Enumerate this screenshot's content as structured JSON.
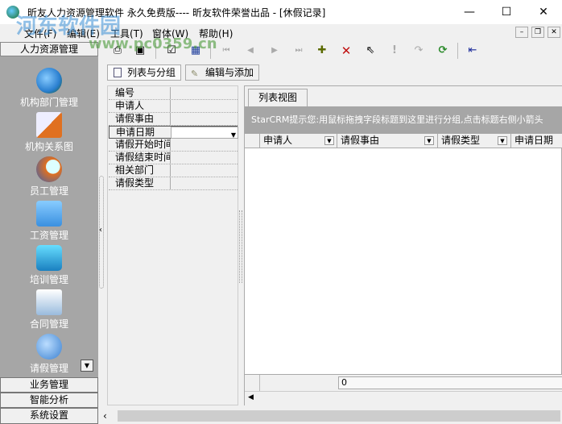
{
  "window": {
    "title": "昕友人力资源管理软件 永久免费版---- 昕友软件荣誉出品  - [休假记录]",
    "minimize": "—",
    "maximize": "☐",
    "close": "✕"
  },
  "menu": [
    "文件(F)",
    "编辑(E)",
    "工具(T)",
    "窗体(W)",
    "帮助(H)"
  ],
  "mdi": {
    "min": "–",
    "restore": "❐",
    "close": "✕"
  },
  "watermark": {
    "text": "河东软件园",
    "url": "www.pc0359.cn"
  },
  "toolbar": [
    {
      "icon": "print-icon",
      "glyph": "⎙"
    },
    {
      "icon": "export-icon",
      "glyph": "▣"
    },
    {
      "icon": "report-icon",
      "glyph": "☑"
    },
    {
      "icon": "grid-icon",
      "glyph": "▦"
    },
    {
      "icon": "first-icon",
      "glyph": "⏮"
    },
    {
      "icon": "prev-icon",
      "glyph": "◀"
    },
    {
      "icon": "next-icon",
      "glyph": "▶"
    },
    {
      "icon": "last-icon",
      "glyph": "⏭"
    },
    {
      "icon": "add-icon",
      "glyph": "✚"
    },
    {
      "icon": "delete-icon",
      "glyph": "✕"
    },
    {
      "icon": "select-icon",
      "glyph": "⇖"
    },
    {
      "icon": "post-icon",
      "glyph": "!"
    },
    {
      "icon": "redo-icon",
      "glyph": "↷"
    },
    {
      "icon": "refresh-icon",
      "glyph": "⟳"
    },
    {
      "icon": "exit-icon",
      "glyph": "⇤"
    }
  ],
  "sidebar": {
    "header": "人力资源管理",
    "items": [
      {
        "label": "机构部门管理",
        "color": "#2a7fd0"
      },
      {
        "label": "机构关系图",
        "color": "#5580c0"
      },
      {
        "label": "员工管理",
        "color": "#e07020"
      },
      {
        "label": "工资管理",
        "color": "#3a90e0"
      },
      {
        "label": "培训管理",
        "color": "#2aa0e0"
      },
      {
        "label": "合同管理",
        "color": "#3a70c0"
      },
      {
        "label": "请假管理",
        "color": "#3a80d0"
      }
    ],
    "groups": [
      "业务管理",
      "智能分析",
      "系统设置"
    ]
  },
  "tabs": [
    "列表与分组",
    "编辑与添加"
  ],
  "fields": [
    "编号",
    "申请人",
    "请假事由",
    "申请日期",
    "请假开始时间",
    "请假结束时间",
    "相关部门",
    "请假类型"
  ],
  "selected_field": "申请日期",
  "grid": {
    "tab": "列表视图",
    "hint": "StarCRM提示您:用鼠标拖拽字段标题到这里进行分组,点击标题右侧小箭头",
    "columns": [
      "申请人",
      "请假事由",
      "请假类型",
      "申请日期"
    ],
    "footer_value": "0"
  }
}
